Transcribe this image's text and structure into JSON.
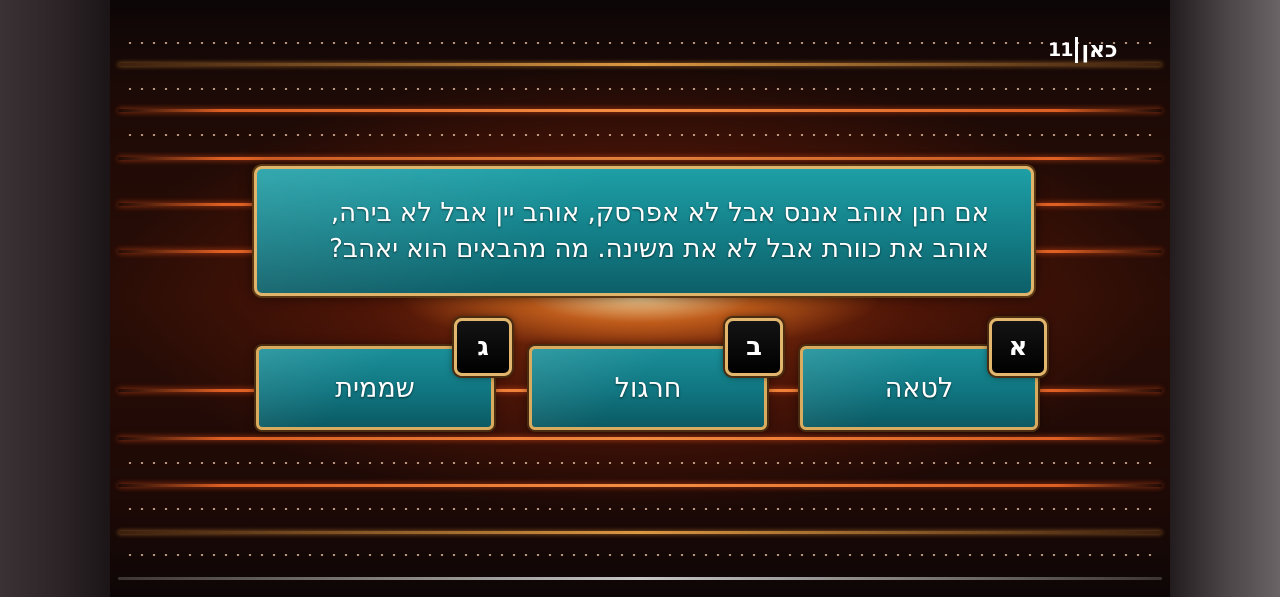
{
  "channel_logo": {
    "number": "11",
    "word": "כאן"
  },
  "question": {
    "text": "אם חנן אוהב אננס אבל לא אפרסק, אוהב יין אבל לא בירה, אוהב את כוורת אבל לא את משינה. מה מהבאים הוא יאהב?"
  },
  "answers": [
    {
      "letter": "א",
      "text": "לטאה"
    },
    {
      "letter": "ב",
      "text": "חרגול"
    },
    {
      "letter": "ג",
      "text": "שממית"
    }
  ],
  "colors": {
    "panel_teal": "#137d86",
    "frame_gold": "#e0b46a",
    "badge_black": "#000000",
    "glow_orange": "#ff6e28"
  }
}
